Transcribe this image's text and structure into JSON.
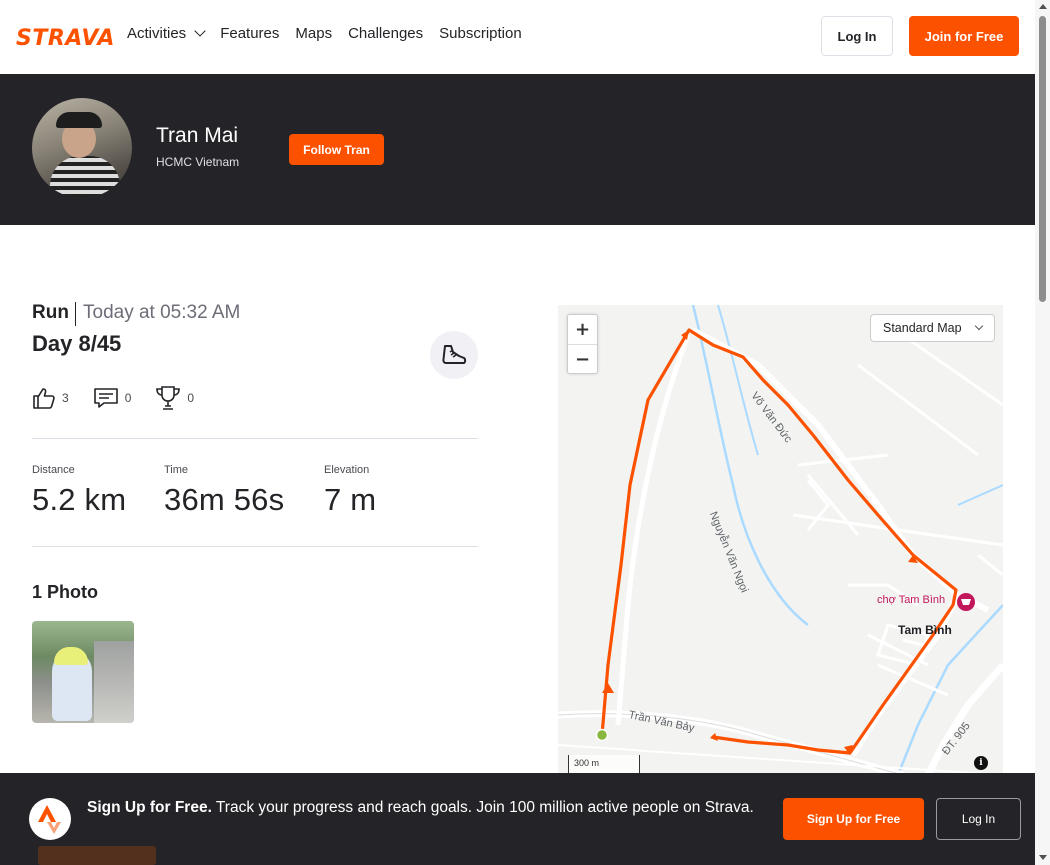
{
  "nav": {
    "logo": "STRAVA",
    "links": [
      "Activities",
      "Features",
      "Maps",
      "Challenges",
      "Subscription"
    ],
    "login_label": "Log In",
    "join_label": "Join for Free"
  },
  "profile": {
    "name": "Tran Mai",
    "location": "HCMC Vietnam",
    "follow_label": "Follow Tran"
  },
  "activity": {
    "type": "Run",
    "time": "Today at 05:32 AM",
    "title": "Day 8/45",
    "kudos": "3",
    "comments": "0",
    "achievements": "0",
    "stats": [
      {
        "label": "Distance",
        "value": "5.2 km"
      },
      {
        "label": "Time",
        "value": "36m 56s"
      },
      {
        "label": "Elevation",
        "value": "7 m"
      }
    ],
    "photos_heading": "1 Photo"
  },
  "map": {
    "zoom_in": "+",
    "zoom_out": "−",
    "map_type": "Standard Map",
    "scale": "300 m",
    "info": "i",
    "labels": {
      "vo_van_duc": "Võ Văn Đức",
      "nguyen_van_ngoi": "Nguyễn Văn Ngọi",
      "cho_tam_binh": "chợ Tam Bình",
      "tam_binh": "Tam Bình",
      "tran_van_bay": "Trần Văn Bảy",
      "dt_905": "ĐT. 905"
    },
    "route_color": "#fc5200"
  },
  "signup_banner": {
    "bold": "Sign Up for Free.",
    "text": " Track your progress and reach goals. Join 100 million active people on Strava.",
    "signup_label": "Sign Up for Free",
    "login_label": "Log In"
  },
  "colors": {
    "brand": "#fc5200",
    "dark": "#242428"
  }
}
